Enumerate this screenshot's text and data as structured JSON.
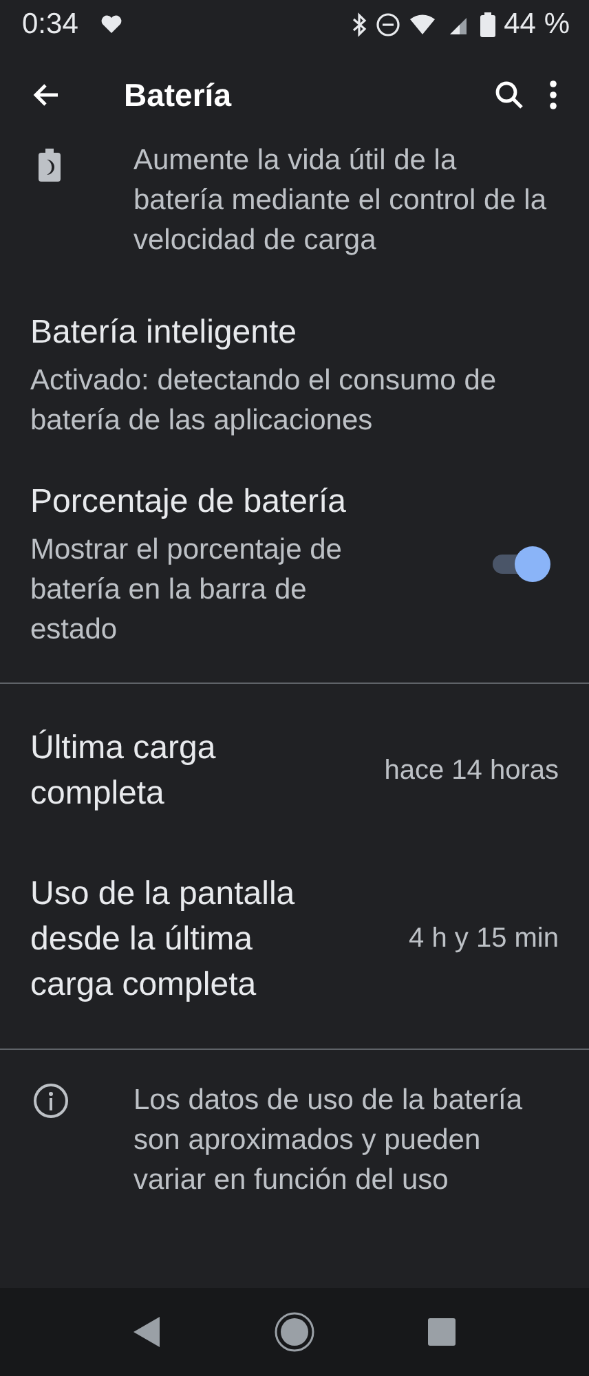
{
  "status_bar": {
    "time": "0:34",
    "battery": "44 %"
  },
  "app_bar": {
    "title": "Batería"
  },
  "sections": [
    {
      "items": [
        {
          "kind": "description",
          "text": "Aumente la vida útil de la batería mediante el control de la velocidad de carga"
        },
        {
          "kind": "setting",
          "title": "Batería inteligente",
          "subtitle": "Activado: detectando el consumo de batería de las aplicaciones"
        },
        {
          "kind": "toggle",
          "title": "Porcentaje de batería",
          "subtitle": "Mostrar el porcentaje de batería en la barra de estado",
          "on": true
        }
      ]
    },
    {
      "items": [
        {
          "kind": "stat",
          "title": "Última carga completa",
          "value": "hace 14 horas"
        },
        {
          "kind": "stat",
          "title": "Uso de la pantalla desde la última carga completa",
          "value": "4 h y 15 min"
        }
      ]
    }
  ],
  "footer": {
    "text": "Los datos de uso de la batería son aproximados y pueden variar en función del uso"
  }
}
